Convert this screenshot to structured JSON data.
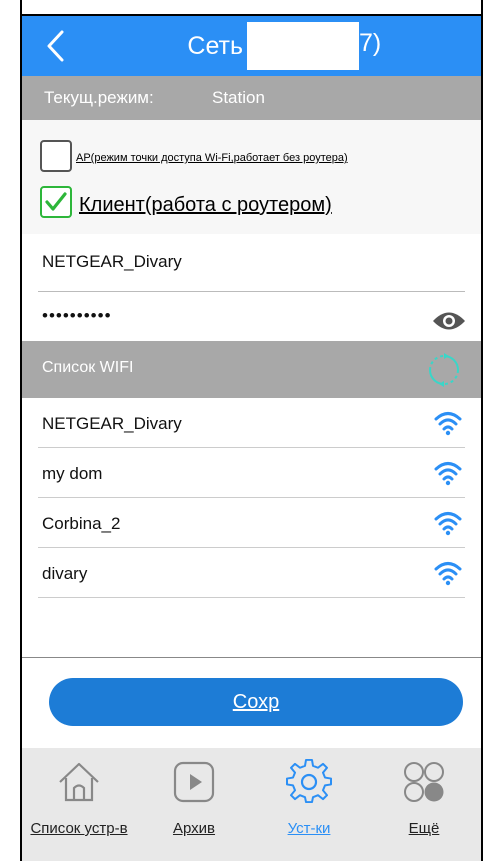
{
  "header": {
    "title": "Сеть  -  (",
    "title_tail": "7)"
  },
  "mode": {
    "label": "Текущ.режим:",
    "value": "Station"
  },
  "options": {
    "ap_label": "AP(режим точки доступа Wi-Fi,работает без роутера)",
    "ap_checked": false,
    "client_label": "Клиент(работа с роутером)",
    "client_checked": true
  },
  "ssid_field": {
    "value": "NETGEAR_Divary"
  },
  "password_field": {
    "value": "••••••••••"
  },
  "wifi_list": {
    "title": "Список WIFI",
    "networks": [
      {
        "name": "NETGEAR_Divary"
      },
      {
        "name": "my dom"
      },
      {
        "name": "Corbina_2"
      },
      {
        "name": "divary"
      }
    ]
  },
  "save_label": "Сохр",
  "tabs": [
    {
      "label": "Список устр-в",
      "icon": "home-icon"
    },
    {
      "label": "Архив",
      "icon": "play-icon"
    },
    {
      "label": "Уст-ки",
      "icon": "gear-icon",
      "active": true
    },
    {
      "label": "Ещё",
      "icon": "more-icon"
    }
  ],
  "colors": {
    "accent": "#2b8ff5",
    "bar_gray": "#a8a8a8",
    "check_green": "#2db63a",
    "button_blue": "#1d7cd6",
    "refresh_teal": "#3ad6c8"
  }
}
